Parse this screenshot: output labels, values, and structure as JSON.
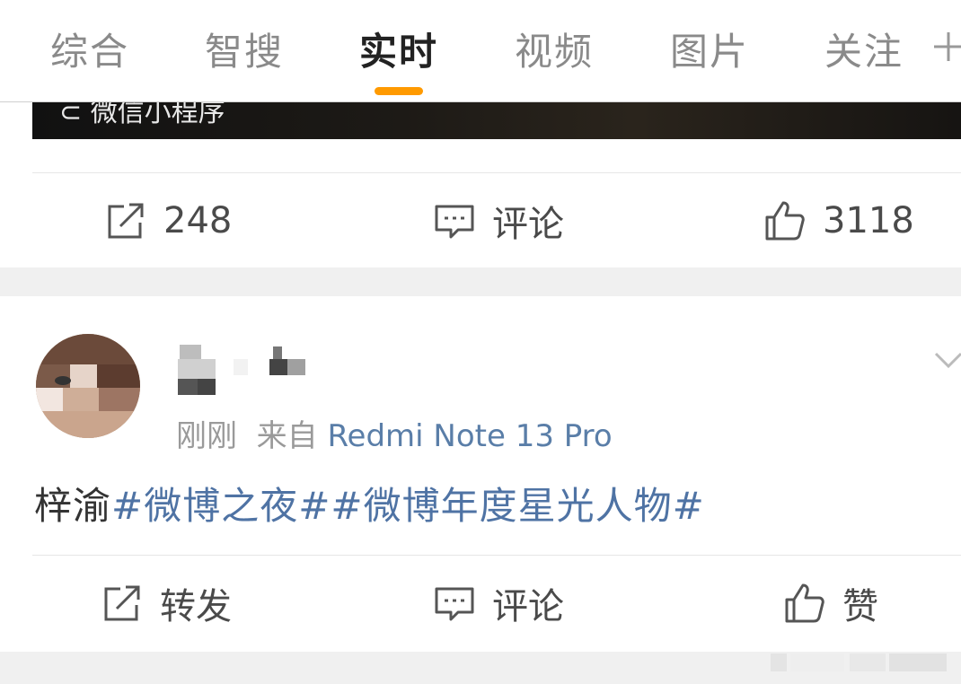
{
  "tabs": [
    {
      "label": "综合"
    },
    {
      "label": "智搜"
    },
    {
      "label": "实时"
    },
    {
      "label": "视频"
    },
    {
      "label": "图片"
    },
    {
      "label": "关注"
    }
  ],
  "colors": {
    "accent": "#ff9a00",
    "link": "#4f73a4",
    "device": "#5a7ea8"
  },
  "top_post": {
    "media_caption": "微信小程序",
    "actions": {
      "repost": "248",
      "comment": "评论",
      "like": "3118"
    }
  },
  "post": {
    "time": "刚刚",
    "source_prefix": "来自",
    "device": "Redmi Note 13 Pro",
    "text_plain": "梓渝",
    "hashtags": [
      "#微博之夜#",
      "#微博年度星光人物#"
    ],
    "actions": {
      "repost": "转发",
      "comment": "评论",
      "like": "赞"
    }
  }
}
